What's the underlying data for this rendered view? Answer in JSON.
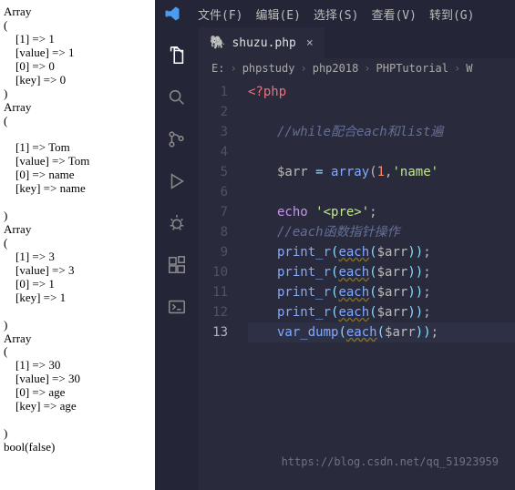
{
  "output": {
    "lines": [
      "Array",
      "(",
      "    [1] => 1",
      "    [value] => 1",
      "    [0] => 0",
      "    [key] => 0",
      ")",
      "Array",
      "(",
      "",
      "    [1] => Tom",
      "    [value] => Tom",
      "    [0] => name",
      "    [key] => name",
      "",
      ")",
      "Array",
      "(",
      "    [1] => 3",
      "    [value] => 3",
      "    [0] => 1",
      "    [key] => 1",
      "",
      ")",
      "Array",
      "(",
      "    [1] => 30",
      "    [value] => 30",
      "    [0] => age",
      "    [key] => age",
      "",
      ")",
      "bool(false)",
      ""
    ]
  },
  "menubar": {
    "items": [
      {
        "label": "文件(F)"
      },
      {
        "label": "编辑(E)"
      },
      {
        "label": "选择(S)"
      },
      {
        "label": "查看(V)"
      },
      {
        "label": "转到(G)"
      }
    ]
  },
  "tab": {
    "label": "shuzu.php",
    "close": "×"
  },
  "breadcrumb": {
    "items": [
      "E:",
      "phpstudy",
      "php2018",
      "PHPTutorial",
      "W"
    ],
    "sep": "›"
  },
  "code": {
    "open_tag": "<?php",
    "comment1": "//while配合each和list遍",
    "arr_var": "$arr",
    "eq": " = ",
    "array_fn": "array",
    "arg1": "1",
    "arg2": "'name'",
    "echo_kw": "echo",
    "echo_str": "'<pre>'",
    "semi": ";",
    "comment2": "//each函数指针操作",
    "print_r": "print_r",
    "each_fn": "each",
    "var_dump": "var_dump",
    "arr_ref": "$arr",
    "paren_open": "(",
    "paren_close": ")"
  },
  "watermark": {
    "text": "https://blog.csdn.net/qq_51923959"
  }
}
